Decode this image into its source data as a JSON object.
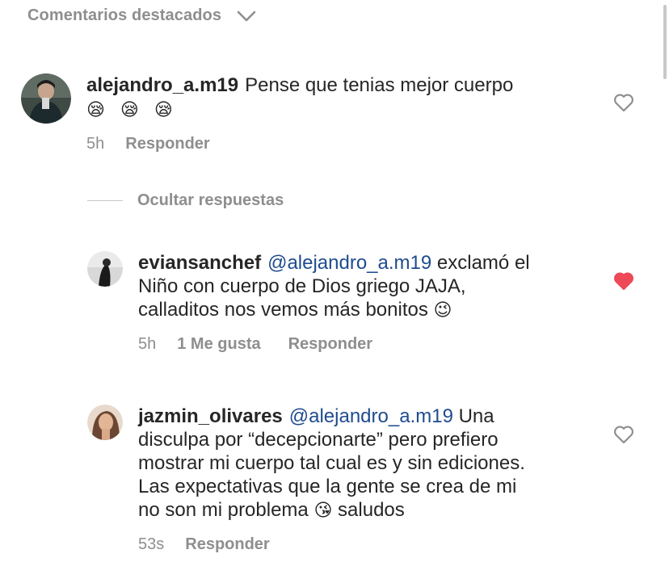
{
  "header": {
    "title": "Comentarios destacados"
  },
  "main_comment": {
    "username": "alejandro_a.m19",
    "text": "Pense que tenias mejor cuerpo",
    "emojis": "😪 😪 😪",
    "time": "5h",
    "reply_label": "Responder",
    "liked": false
  },
  "hide_replies_label": "Ocultar respuestas",
  "replies": [
    {
      "username": "eviansanchef",
      "mention": "@alejandro_a.m19",
      "text_line1_rest": " exclamó el",
      "text_line2": "Niño con cuerpo de Dios griego JAJA,",
      "text_line3": "calladitos nos vemos más bonitos",
      "emoji": "😉",
      "time": "5h",
      "likes_label": "1 Me gusta",
      "reply_label": "Responder",
      "liked": true
    },
    {
      "username": "jazmin_olivares",
      "mention": "@alejandro_a.m19",
      "text_line1_rest": " Una",
      "text_line2": "disculpa por “decepcionarte”  pero prefiero",
      "text_line3": "mostrar mi cuerpo tal cual es y sin ediciones.",
      "text_line4": "Las expectativas que la gente se crea de mi",
      "text_line5": "no son mi problema",
      "emoji": "😘",
      "text_line5_end": " saludos",
      "time": "53s",
      "reply_label": "Responder",
      "liked": false
    }
  ],
  "colors": {
    "heart_liked": "#ed4956",
    "mention": "#1f4c8f",
    "meta": "#8e8e8e"
  }
}
